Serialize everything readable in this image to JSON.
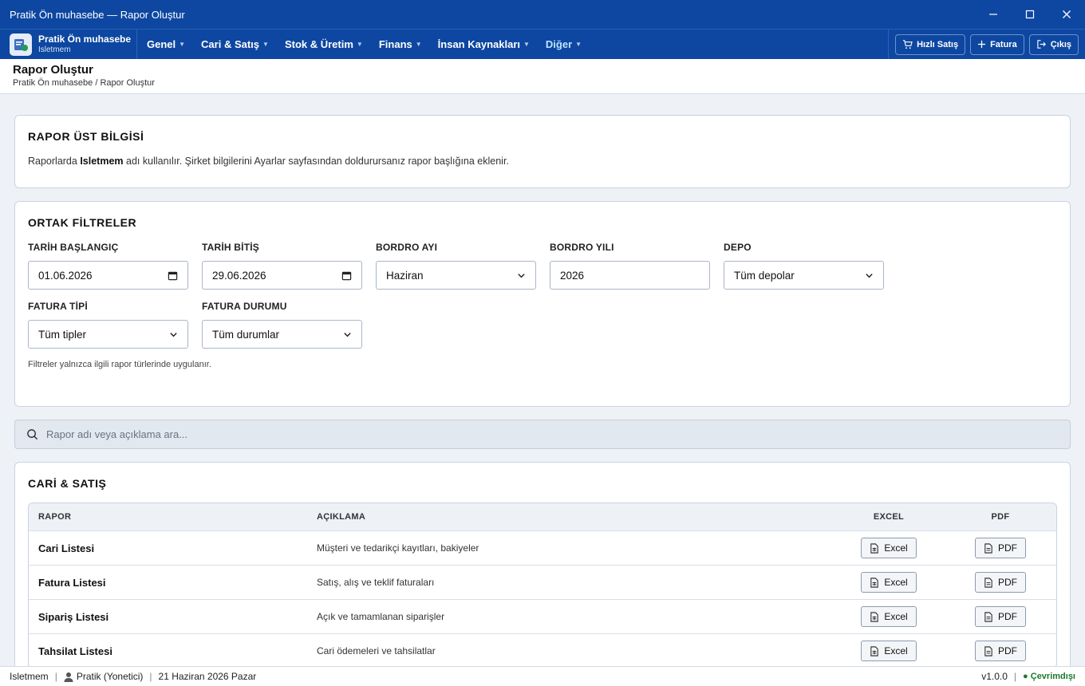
{
  "window": {
    "title": "Pratik Ön muhasebe — Rapor Oluştur"
  },
  "brand": {
    "name": "Pratik Ön muhasebe",
    "sub": "Isletmem"
  },
  "menu": [
    {
      "label": "Genel"
    },
    {
      "label": "Cari & Satış"
    },
    {
      "label": "Stok & Üretim"
    },
    {
      "label": "Finans"
    },
    {
      "label": "İnsan Kaynakları"
    },
    {
      "label": "Diğer"
    }
  ],
  "actions": {
    "quick_sale": "Hızlı Satış",
    "invoice": "Fatura",
    "exit": "Çıkış"
  },
  "page": {
    "title": "Rapor Oluştur",
    "breadcrumb": "Pratik Ön muhasebe / Rapor Oluştur"
  },
  "info": {
    "heading": "RAPOR ÜST BİLGİSİ",
    "pre": "Raporlarda",
    "company": "Isletmem",
    "post": "adı kullanılır. Şirket bilgilerini Ayarlar sayfasından doldurursanız rapor başlığına eklenir."
  },
  "filters": {
    "heading": "ORTAK FİLTRELER",
    "date_start": {
      "label": "TARİH BAŞLANGIÇ",
      "value": "01.06.2026"
    },
    "date_end": {
      "label": "TARİH BİTİŞ",
      "value": "29.06.2026"
    },
    "payroll_month": {
      "label": "BORDRO AYI",
      "value": "Haziran"
    },
    "payroll_year": {
      "label": "BORDRO YILI",
      "value": "2026"
    },
    "warehouse": {
      "label": "DEPO",
      "value": "Tüm depolar"
    },
    "invoice_type": {
      "label": "FATURA TİPİ",
      "value": "Tüm tipler"
    },
    "invoice_status": {
      "label": "FATURA DURUMU",
      "value": "Tüm durumlar"
    },
    "hint": "Filtreler yalnızca ilgili rapor türlerinde uygulanır."
  },
  "search": {
    "placeholder": "Rapor adı veya açıklama ara..."
  },
  "section": {
    "heading": "CARİ & SATIŞ",
    "columns": {
      "report": "RAPOR",
      "desc": "AÇIKLAMA",
      "excel": "EXCEL",
      "pdf": "PDF"
    },
    "rows": [
      {
        "name": "Cari Listesi",
        "desc": "Müşteri ve tedarikçi kayıtları, bakiyeler",
        "excel": "Excel",
        "pdf": "PDF"
      },
      {
        "name": "Fatura Listesi",
        "desc": "Satış, alış ve teklif faturaları",
        "excel": "Excel",
        "pdf": "PDF"
      },
      {
        "name": "Sipariş Listesi",
        "desc": "Açık ve tamamlanan siparişler",
        "excel": "Excel",
        "pdf": "PDF"
      },
      {
        "name": "Tahsilat Listesi",
        "desc": "Cari ödemeleri ve tahsilatlar",
        "excel": "Excel",
        "pdf": "PDF"
      }
    ]
  },
  "status": {
    "company": "Isletmem",
    "user": "Pratik (Yonetici)",
    "date": "21 Haziran 2026 Pazar",
    "version": "v1.0.0",
    "connection": "● Çevrimdışı"
  },
  "colors": {
    "primary": "#0d47a1",
    "background": "#eef2f7",
    "online": "#1b7a2a"
  }
}
